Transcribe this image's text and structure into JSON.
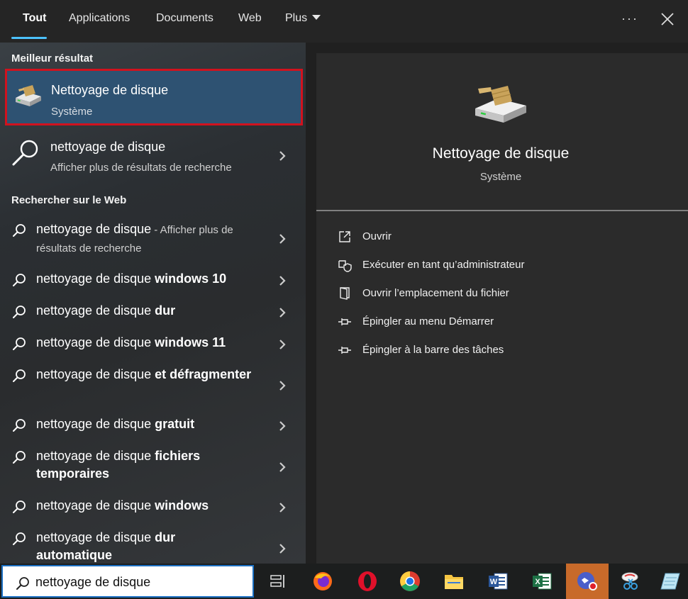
{
  "tabs": {
    "all": "Tout",
    "apps": "Applications",
    "docs": "Documents",
    "web": "Web",
    "more": "Plus"
  },
  "window": {
    "more_label": "···"
  },
  "best_match": {
    "section": "Meilleur résultat",
    "title": "Nettoyage de disque",
    "subtitle": "Système"
  },
  "suggestion": {
    "title": "nettoyage de disque",
    "subtitle": "Afficher plus de résultats de recherche"
  },
  "web": {
    "section": "Rechercher sur le Web",
    "first": {
      "prefix": "nettoyage de disque",
      "suffix": " - Afficher plus de résultats de recherche"
    },
    "items": [
      {
        "prefix": "nettoyage de disque ",
        "bold": "windows 10"
      },
      {
        "prefix": "nettoyage de disque ",
        "bold": "dur"
      },
      {
        "prefix": "nettoyage de disque ",
        "bold": "windows 11"
      },
      {
        "prefix": "nettoyage de disque ",
        "bold": "et défragmenter"
      },
      {
        "prefix": "nettoyage de disque ",
        "bold": "gratuit"
      },
      {
        "prefix": "nettoyage de disque ",
        "bold": "fichiers temporaires"
      },
      {
        "prefix": "nettoyage de disque ",
        "bold": "windows"
      },
      {
        "prefix": "nettoyage de disque ",
        "bold": "dur automatique"
      }
    ]
  },
  "details": {
    "title": "Nettoyage de disque",
    "subtitle": "Système",
    "actions": {
      "open": "Ouvrir",
      "run_admin": "Exécuter en tant qu’administrateur",
      "open_location": "Ouvrir l’emplacement du fichier",
      "pin_start": "Épingler au menu Démarrer",
      "pin_taskbar": "Épingler à la barre des tâches"
    }
  },
  "search": {
    "value": "nettoyage de disque"
  },
  "colors": {
    "accent": "#4cc2ff",
    "selected_bg": "#2e5272",
    "highlight_border": "#d1121e"
  }
}
